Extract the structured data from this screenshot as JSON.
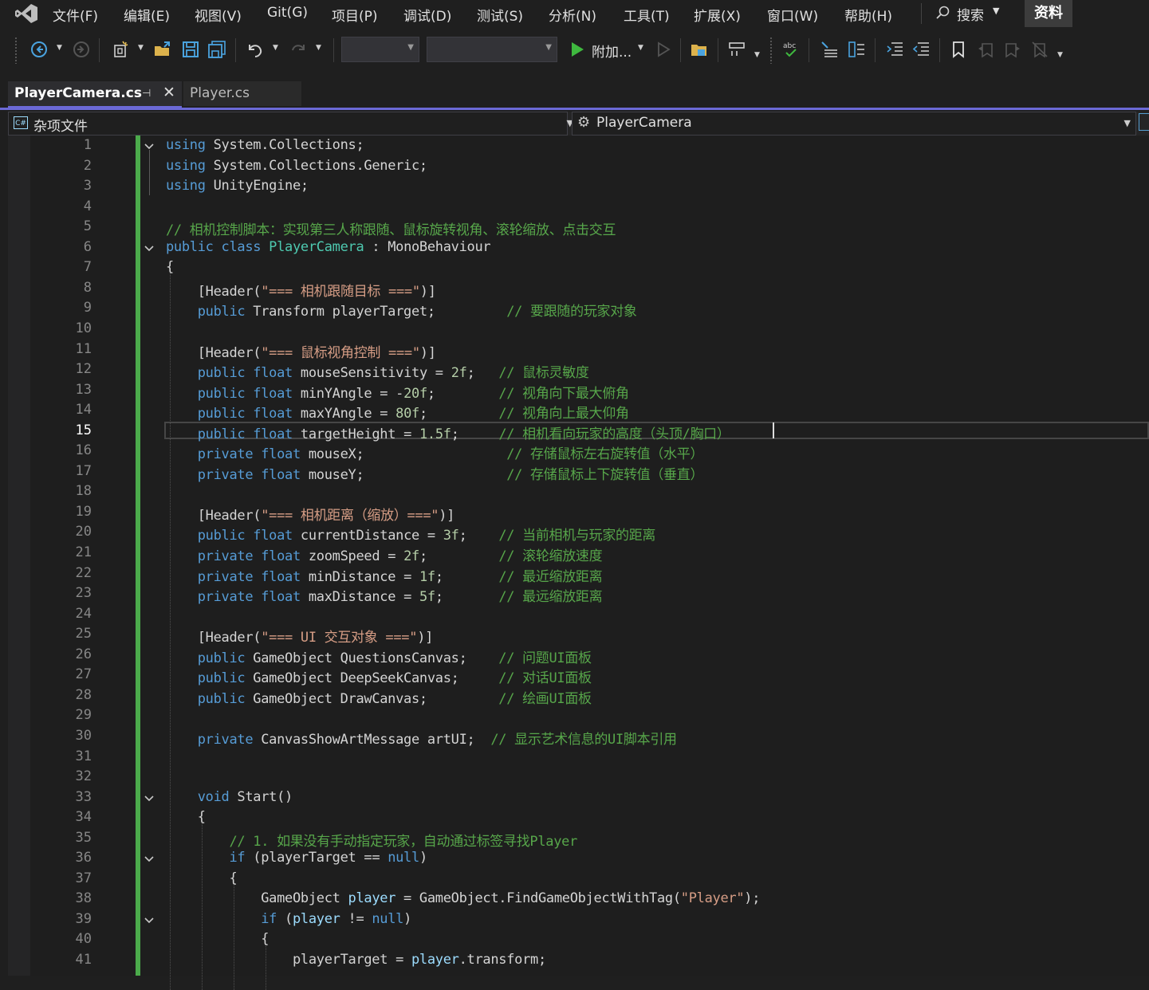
{
  "menu": {
    "items": [
      "文件(F)",
      "编辑(E)",
      "视图(V)",
      "Git(G)",
      "项目(P)",
      "调试(D)",
      "测试(S)",
      "分析(N)",
      "工具(T)",
      "扩展(X)",
      "窗口(W)",
      "帮助(H)"
    ],
    "search_label": "搜索",
    "resource_button": "资料"
  },
  "toolbar": {
    "attach_label": "附加...",
    "icons": [
      "back-icon",
      "forward-icon",
      "new-project-icon",
      "open-folder-icon",
      "save-icon",
      "save-all-icon",
      "undo-icon",
      "redo-icon",
      "start-icon",
      "start-without-debug-icon",
      "open-file-folder-icon",
      "format-icon",
      "spell-check-icon",
      "comment-icon",
      "uncomment-icon",
      "indent-icon",
      "outdent-icon",
      "bookmark-icon",
      "prev-bookmark-icon",
      "next-bookmark-icon",
      "clear-bookmarks-icon"
    ]
  },
  "tabs": {
    "active": "PlayerCamera.cs",
    "inactive": "Player.cs"
  },
  "navbar": {
    "project": "杂项文件",
    "class": "PlayerCamera"
  },
  "editor": {
    "current_line": 15,
    "line_numbers": [
      "1",
      "2",
      "3",
      "4",
      "5",
      "6",
      "7",
      "8",
      "9",
      "10",
      "11",
      "12",
      "13",
      "14",
      "15",
      "16",
      "17",
      "18",
      "19",
      "20",
      "21",
      "22",
      "23",
      "24",
      "25",
      "26",
      "27",
      "28",
      "29",
      "30",
      "31",
      "32",
      "33",
      "34",
      "35",
      "36",
      "37",
      "38",
      "39",
      "40",
      "41"
    ],
    "lines": [
      [
        [
          "k",
          "using"
        ],
        [
          "p",
          " System.Collections;"
        ]
      ],
      [
        [
          "k",
          "using"
        ],
        [
          "p",
          " System.Collections.Generic;"
        ]
      ],
      [
        [
          "k",
          "using"
        ],
        [
          "p",
          " UnityEngine;"
        ]
      ],
      [],
      [
        [
          "c",
          "// 相机控制脚本：实现第三人称跟随、鼠标旋转视角、滚轮缩放、点击交互"
        ]
      ],
      [
        [
          "k",
          "public"
        ],
        [
          "p",
          " "
        ],
        [
          "k",
          "class"
        ],
        [
          "p",
          " "
        ],
        [
          "t",
          "PlayerCamera"
        ],
        [
          "p",
          " : MonoBehaviour"
        ]
      ],
      [
        [
          "p",
          "{"
        ]
      ],
      [
        [
          "p",
          "    [Header("
        ],
        [
          "s",
          "\"=== 相机跟随目标 ===\""
        ],
        [
          "p",
          ")]"
        ]
      ],
      [
        [
          "p",
          "    "
        ],
        [
          "k",
          "public"
        ],
        [
          "p",
          " Transform playerTarget;         "
        ],
        [
          "c",
          "// 要跟随的玩家对象"
        ]
      ],
      [],
      [
        [
          "p",
          "    [Header("
        ],
        [
          "s",
          "\"=== 鼠标视角控制 ===\""
        ],
        [
          "p",
          ")]"
        ]
      ],
      [
        [
          "p",
          "    "
        ],
        [
          "k",
          "public"
        ],
        [
          "p",
          " "
        ],
        [
          "k",
          "float"
        ],
        [
          "p",
          " mouseSensitivity = "
        ],
        [
          "n",
          "2f"
        ],
        [
          "p",
          ";   "
        ],
        [
          "c",
          "// 鼠标灵敏度"
        ]
      ],
      [
        [
          "p",
          "    "
        ],
        [
          "k",
          "public"
        ],
        [
          "p",
          " "
        ],
        [
          "k",
          "float"
        ],
        [
          "p",
          " minYAngle = -"
        ],
        [
          "n",
          "20f"
        ],
        [
          "p",
          ";        "
        ],
        [
          "c",
          "// 视角向下最大俯角"
        ]
      ],
      [
        [
          "p",
          "    "
        ],
        [
          "k",
          "public"
        ],
        [
          "p",
          " "
        ],
        [
          "k",
          "float"
        ],
        [
          "p",
          " maxYAngle = "
        ],
        [
          "n",
          "80f"
        ],
        [
          "p",
          ";         "
        ],
        [
          "c",
          "// 视角向上最大仰角"
        ]
      ],
      [
        [
          "p",
          "    "
        ],
        [
          "k",
          "public"
        ],
        [
          "p",
          " "
        ],
        [
          "k",
          "float"
        ],
        [
          "p",
          " targetHeight = "
        ],
        [
          "n",
          "1.5f"
        ],
        [
          "p",
          ";     "
        ],
        [
          "c",
          "// 相机看向玩家的高度（头顶/胸口）"
        ]
      ],
      [
        [
          "p",
          "    "
        ],
        [
          "k",
          "private"
        ],
        [
          "p",
          " "
        ],
        [
          "k",
          "float"
        ],
        [
          "p",
          " mouseX;                  "
        ],
        [
          "c",
          "// 存储鼠标左右旋转值（水平）"
        ]
      ],
      [
        [
          "p",
          "    "
        ],
        [
          "k",
          "private"
        ],
        [
          "p",
          " "
        ],
        [
          "k",
          "float"
        ],
        [
          "p",
          " mouseY;                  "
        ],
        [
          "c",
          "// 存储鼠标上下旋转值（垂直）"
        ]
      ],
      [],
      [
        [
          "p",
          "    [Header("
        ],
        [
          "s",
          "\"=== 相机距离（缩放）===\""
        ],
        [
          "p",
          ")]"
        ]
      ],
      [
        [
          "p",
          "    "
        ],
        [
          "k",
          "public"
        ],
        [
          "p",
          " "
        ],
        [
          "k",
          "float"
        ],
        [
          "p",
          " currentDistance = "
        ],
        [
          "n",
          "3f"
        ],
        [
          "p",
          ";    "
        ],
        [
          "c",
          "// 当前相机与玩家的距离"
        ]
      ],
      [
        [
          "p",
          "    "
        ],
        [
          "k",
          "private"
        ],
        [
          "p",
          " "
        ],
        [
          "k",
          "float"
        ],
        [
          "p",
          " zoomSpeed = "
        ],
        [
          "n",
          "2f"
        ],
        [
          "p",
          ";         "
        ],
        [
          "c",
          "// 滚轮缩放速度"
        ]
      ],
      [
        [
          "p",
          "    "
        ],
        [
          "k",
          "private"
        ],
        [
          "p",
          " "
        ],
        [
          "k",
          "float"
        ],
        [
          "p",
          " minDistance = "
        ],
        [
          "n",
          "1f"
        ],
        [
          "p",
          ";       "
        ],
        [
          "c",
          "// 最近缩放距离"
        ]
      ],
      [
        [
          "p",
          "    "
        ],
        [
          "k",
          "private"
        ],
        [
          "p",
          " "
        ],
        [
          "k",
          "float"
        ],
        [
          "p",
          " maxDistance = "
        ],
        [
          "n",
          "5f"
        ],
        [
          "p",
          ";       "
        ],
        [
          "c",
          "// 最远缩放距离"
        ]
      ],
      [],
      [
        [
          "p",
          "    [Header("
        ],
        [
          "s",
          "\"=== UI 交互对象 ===\""
        ],
        [
          "p",
          ")]"
        ]
      ],
      [
        [
          "p",
          "    "
        ],
        [
          "k",
          "public"
        ],
        [
          "p",
          " GameObject QuestionsCanvas;    "
        ],
        [
          "c",
          "// 问题UI面板"
        ]
      ],
      [
        [
          "p",
          "    "
        ],
        [
          "k",
          "public"
        ],
        [
          "p",
          " GameObject DeepSeekCanvas;     "
        ],
        [
          "c",
          "// 对话UI面板"
        ]
      ],
      [
        [
          "p",
          "    "
        ],
        [
          "k",
          "public"
        ],
        [
          "p",
          " GameObject DrawCanvas;         "
        ],
        [
          "c",
          "// 绘画UI面板"
        ]
      ],
      [],
      [
        [
          "p",
          "    "
        ],
        [
          "k",
          "private"
        ],
        [
          "p",
          " CanvasShowArtMessage artUI;  "
        ],
        [
          "c",
          "// 显示艺术信息的UI脚本引用"
        ]
      ],
      [],
      [],
      [
        [
          "p",
          "    "
        ],
        [
          "k",
          "void"
        ],
        [
          "p",
          " Start()"
        ]
      ],
      [
        [
          "p",
          "    {"
        ]
      ],
      [
        [
          "p",
          "        "
        ],
        [
          "c",
          "// 1. 如果没有手动指定玩家，自动通过标签寻找Player"
        ]
      ],
      [
        [
          "p",
          "        "
        ],
        [
          "k",
          "if"
        ],
        [
          "p",
          " (playerTarget == "
        ],
        [
          "k",
          "null"
        ],
        [
          "p",
          ")"
        ]
      ],
      [
        [
          "p",
          "        {"
        ]
      ],
      [
        [
          "p",
          "            GameObject "
        ],
        [
          "v",
          "player"
        ],
        [
          "p",
          " = GameObject.FindGameObjectWithTag("
        ],
        [
          "s",
          "\"Player\""
        ],
        [
          "p",
          ");"
        ]
      ],
      [
        [
          "p",
          "            "
        ],
        [
          "k",
          "if"
        ],
        [
          "p",
          " ("
        ],
        [
          "v",
          "player"
        ],
        [
          "p",
          " != "
        ],
        [
          "k",
          "null"
        ],
        [
          "p",
          ")"
        ]
      ],
      [
        [
          "p",
          "            {"
        ]
      ],
      [
        [
          "p",
          "                playerTarget = "
        ],
        [
          "v",
          "player"
        ],
        [
          "p",
          ".transform;"
        ]
      ]
    ],
    "fold_lines": [
      1,
      6,
      33,
      36,
      39
    ]
  },
  "colors": {
    "keyword": "#569cd6",
    "type": "#4ec9b0",
    "comment": "#57a64a",
    "string": "#d69d85",
    "variable": "#9cdcfe",
    "number": "#b5cea8",
    "plain": "#d4d4d4",
    "change_bar": "#4bab4b",
    "tab_accent": "#6b69d6"
  }
}
